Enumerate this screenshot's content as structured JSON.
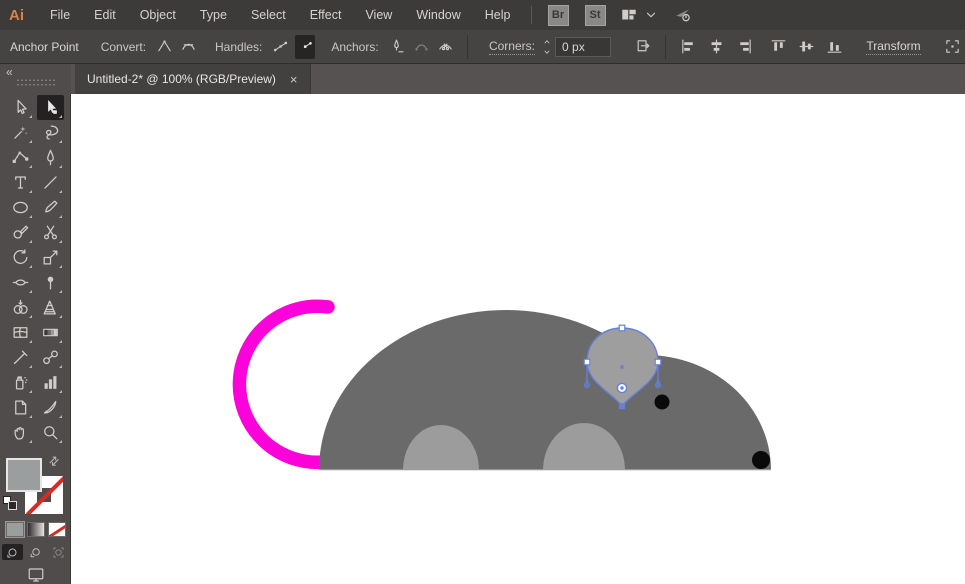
{
  "app": {
    "logo": "Ai",
    "logo_color": "#DD8144"
  },
  "menubar": {
    "items": [
      "File",
      "Edit",
      "Object",
      "Type",
      "Select",
      "Effect",
      "View",
      "Window",
      "Help"
    ],
    "bridge_button": "Br",
    "stock_button": "St"
  },
  "controlbar": {
    "context_label": "Anchor Point",
    "convert_label": "Convert:",
    "handles_label": "Handles:",
    "anchors_label": "Anchors:",
    "corners_label": "Corners:",
    "corners_value": "0 px",
    "transform_label": "Transform"
  },
  "tabbar": {
    "collapse_glyph": "«",
    "document_title": "Untitled-2* @ 100% (RGB/Preview)",
    "close_glyph": "×"
  },
  "toolbar": {
    "tools": [
      {
        "name": "selection-tool",
        "selected": false
      },
      {
        "name": "direct-selection-tool",
        "selected": true
      },
      {
        "name": "magic-wand-tool",
        "selected": false
      },
      {
        "name": "lasso-tool",
        "selected": false
      },
      {
        "name": "curvature-tool",
        "selected": false
      },
      {
        "name": "pen-tool",
        "selected": false
      },
      {
        "name": "type-tool",
        "selected": false
      },
      {
        "name": "line-segment-tool",
        "selected": false
      },
      {
        "name": "ellipse-tool",
        "selected": false
      },
      {
        "name": "paintbrush-tool",
        "selected": false
      },
      {
        "name": "shaper-tool",
        "selected": false
      },
      {
        "name": "scissors-tool",
        "selected": false
      },
      {
        "name": "rotate-tool",
        "selected": false
      },
      {
        "name": "scale-tool",
        "selected": false
      },
      {
        "name": "width-tool",
        "selected": false
      },
      {
        "name": "puppet-warp-tool",
        "selected": false
      },
      {
        "name": "shape-builder-tool",
        "selected": false
      },
      {
        "name": "perspective-grid-tool",
        "selected": false
      },
      {
        "name": "mesh-tool",
        "selected": false
      },
      {
        "name": "gradient-tool",
        "selected": false
      },
      {
        "name": "eyedropper-tool",
        "selected": false
      },
      {
        "name": "blend-tool",
        "selected": false
      },
      {
        "name": "symbol-sprayer-tool",
        "selected": false
      },
      {
        "name": "column-graph-tool",
        "selected": false
      },
      {
        "name": "artboard-tool",
        "selected": false
      },
      {
        "name": "slice-tool",
        "selected": false
      },
      {
        "name": "hand-tool",
        "selected": false
      },
      {
        "name": "zoom-tool",
        "selected": false
      }
    ],
    "fill_swatch_color": "#9B9E9E",
    "stroke_swatch": "none"
  },
  "artwork": {
    "subject": "cartoon mouse with selected ear shape",
    "colors": {
      "canvas": "#FFFFFF",
      "body": "#6A6A6A",
      "ear": "#9E9E9E",
      "legs": "#9C9C9C",
      "tail": "#FB02DB",
      "eye": "#0A0A0A",
      "nose": "#0A0A0A",
      "selection": "#647FDC",
      "anchor_fill": "#FFFFFF",
      "ground_line": "#C4C4C4"
    }
  }
}
